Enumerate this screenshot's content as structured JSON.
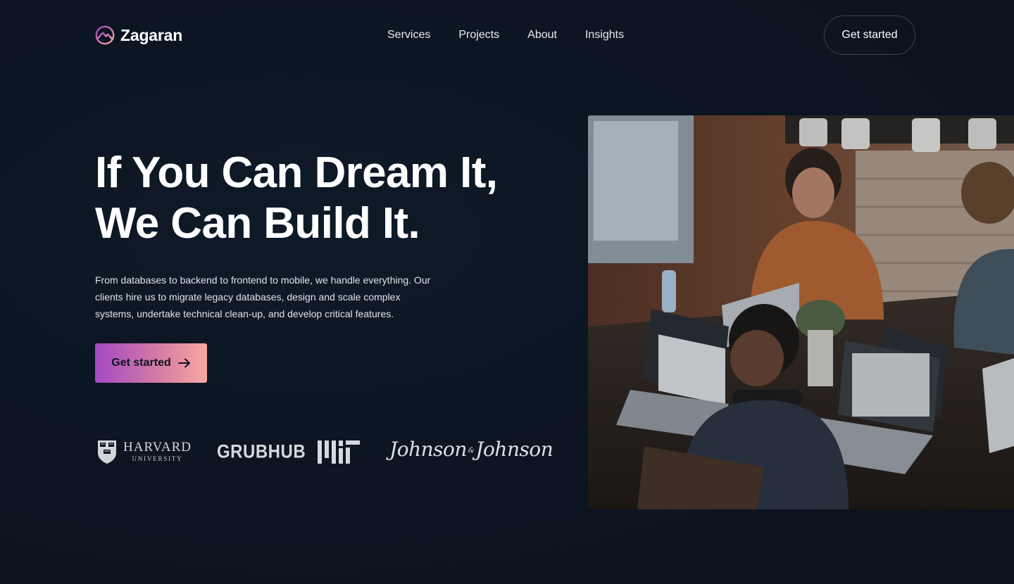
{
  "brand": {
    "name": "Zagaran",
    "logo_icon": "mountain-circle-icon",
    "accent_gradient": [
      "#a349c4",
      "#f6a8a0"
    ]
  },
  "nav": {
    "items": [
      {
        "label": "Services"
      },
      {
        "label": "Projects"
      },
      {
        "label": "About"
      },
      {
        "label": "Insights"
      }
    ],
    "cta_label": "Get started"
  },
  "hero": {
    "title_line1": "If You Can Dream It,",
    "title_line2": "We Can Build It.",
    "description": "From databases to backend to frontend to mobile, we handle everything. Our clients hire us to migrate legacy databases, design and scale complex systems, undertake technical clean-up, and develop critical features.",
    "cta_label": "Get started",
    "cta_icon": "arrow-right-icon",
    "image_alt": "team-working-on-laptops-photo"
  },
  "clients": {
    "harvard_name": "HARVARD",
    "harvard_sub": "UNIVERSITY",
    "grubhub": "GRUBHUB",
    "mit": "MIT",
    "jnj_left": "Johnson",
    "jnj_amp": "&",
    "jnj_right": "Johnson"
  },
  "colors": {
    "background": "#0b1420",
    "text": "#ffffff",
    "border": "#3a4554"
  }
}
